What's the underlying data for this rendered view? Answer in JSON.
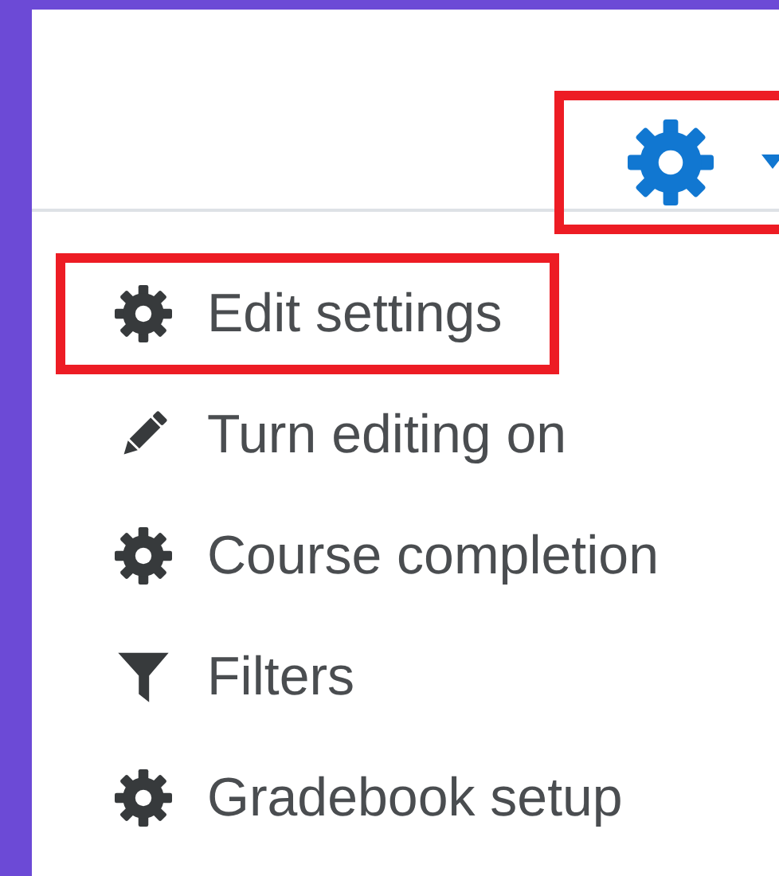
{
  "settings_button": {
    "highlighted": true
  },
  "menu_items": [
    {
      "label": "Edit settings",
      "kind": "gear",
      "highlighted": true
    },
    {
      "label": "Turn editing on",
      "kind": "pencil",
      "highlighted": false
    },
    {
      "label": "Course completion",
      "kind": "gear",
      "highlighted": false
    },
    {
      "label": "Filters",
      "kind": "filter",
      "highlighted": false
    },
    {
      "label": "Gradebook setup",
      "kind": "gear",
      "highlighted": false
    }
  ]
}
